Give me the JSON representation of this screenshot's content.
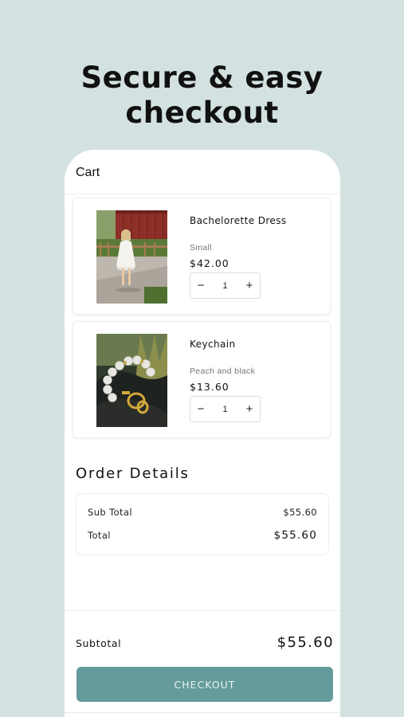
{
  "headline": {
    "line1": "Secure & easy",
    "line2": "checkout"
  },
  "cart": {
    "title": "Cart",
    "items": [
      {
        "name": "Bachelorette Dress",
        "variant": "Small",
        "price": "$42.00",
        "quantity": "1",
        "decrement": "−",
        "increment": "+"
      },
      {
        "name": "Keychain",
        "variant": "Peach and black",
        "price": "$13.60",
        "quantity": "1",
        "decrement": "−",
        "increment": "+"
      }
    ]
  },
  "order_details": {
    "title": "Order Details",
    "sub_total_label": "Sub Total",
    "sub_total_value": "$55.60",
    "total_label": "Total",
    "total_value": "$55.60"
  },
  "footer": {
    "subtotal_label": "Subtotal",
    "subtotal_value": "$55.60",
    "checkout_label": "CHECKOUT"
  },
  "colors": {
    "background": "#d3e1e1",
    "accent": "#659b9a"
  }
}
